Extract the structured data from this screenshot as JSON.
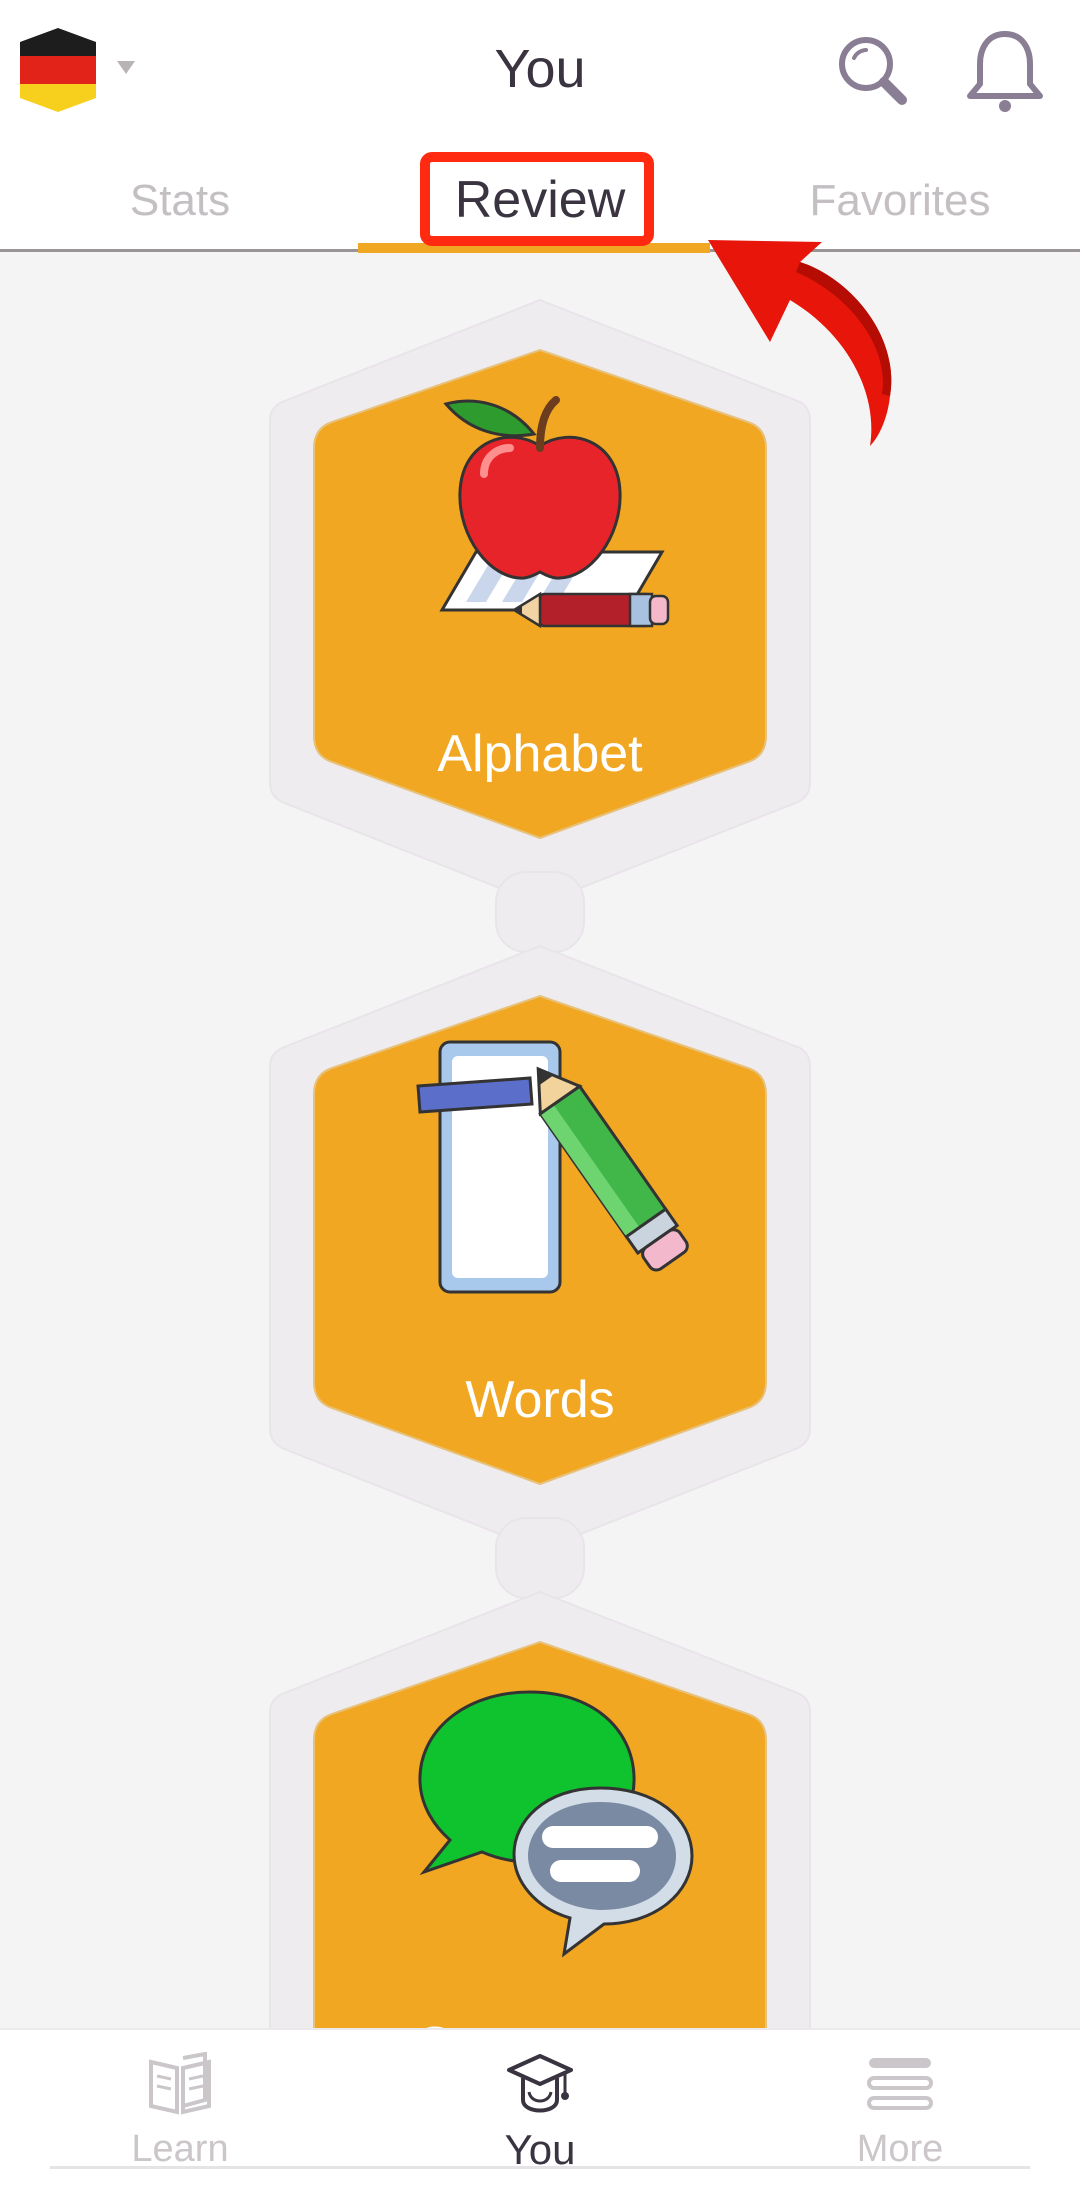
{
  "header": {
    "title": "You",
    "language_flag_icon": "germany-flag-icon",
    "dropdown_icon": "caret-down-icon",
    "search_icon": "search-icon",
    "notifications_icon": "bell-icon"
  },
  "tabs": [
    {
      "label": "Stats",
      "selected": false
    },
    {
      "label": "Review",
      "selected": true
    },
    {
      "label": "Favorites",
      "selected": false
    }
  ],
  "review_items": [
    {
      "label": "Alphabet",
      "icon": "apple-paper-pencil-icon"
    },
    {
      "label": "Words",
      "icon": "flashcard-pencil-icon"
    },
    {
      "label": "Sentences",
      "icon": "speech-bubbles-icon"
    }
  ],
  "bottom_nav": [
    {
      "label": "Learn",
      "icon": "open-book-icon",
      "active": false
    },
    {
      "label": "You",
      "icon": "graduation-cap-icon",
      "active": true
    },
    {
      "label": "More",
      "icon": "menu-lines-icon",
      "active": false
    }
  ],
  "colors": {
    "accent": "#f0a723",
    "card": "#f2a723",
    "highlight": "#ff2a10",
    "text_dark": "#3a3340",
    "text_muted": "#c4bfc3",
    "background": "#f5f4f5"
  }
}
